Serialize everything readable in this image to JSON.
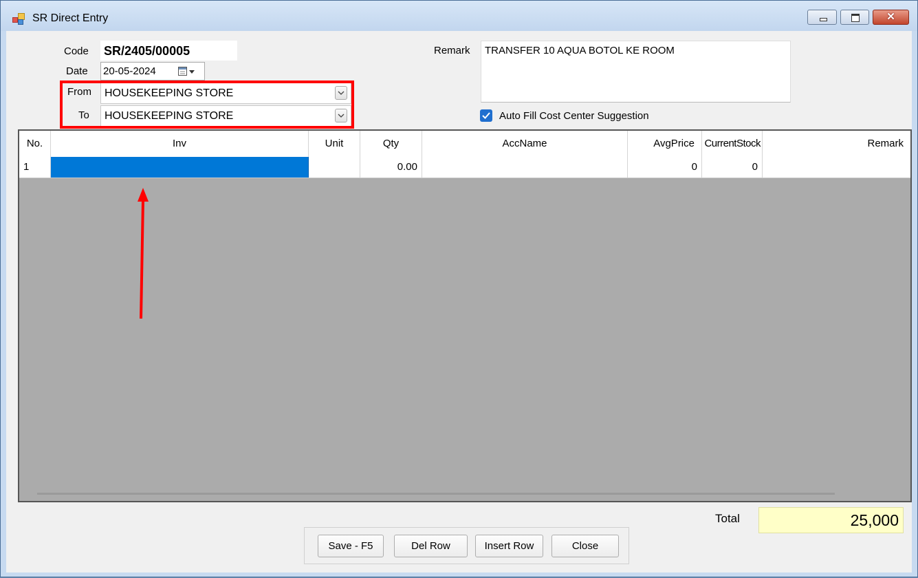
{
  "window": {
    "title": "SR Direct Entry",
    "controls": {
      "close_glyph": "✕"
    }
  },
  "form": {
    "code_label": "Code",
    "code_value": "SR/2405/00005",
    "date_label": "Date",
    "date_value": "20-05-2024",
    "from_label": "From",
    "from_value": "HOUSEKEEPING STORE",
    "to_label": "To",
    "to_value": "HOUSEKEEPING STORE",
    "remark_label": "Remark",
    "remark_value": "TRANSFER 10 AQUA BOTOL KE ROOM",
    "autofill_label": "Auto Fill Cost Center Suggestion",
    "autofill_checked": true
  },
  "grid": {
    "columns": [
      "No.",
      "Inv",
      "Unit",
      "Qty",
      "AccName",
      "AvgPrice",
      "CurrentStock",
      "Remark"
    ],
    "rows": [
      {
        "no": "1",
        "inv": "",
        "unit": "",
        "qty": "0.00",
        "accname": "",
        "avgprice": "0",
        "currentstock": "0",
        "remark": ""
      }
    ]
  },
  "footer": {
    "total_label": "Total",
    "total_value": "25,000",
    "buttons": {
      "save": "Save - F5",
      "del_row": "Del Row",
      "insert_row": "Insert Row",
      "close": "Close"
    }
  },
  "colors": {
    "annotation": "#ff0000",
    "selection": "#0078d7",
    "total_bg": "#ffffc8"
  }
}
